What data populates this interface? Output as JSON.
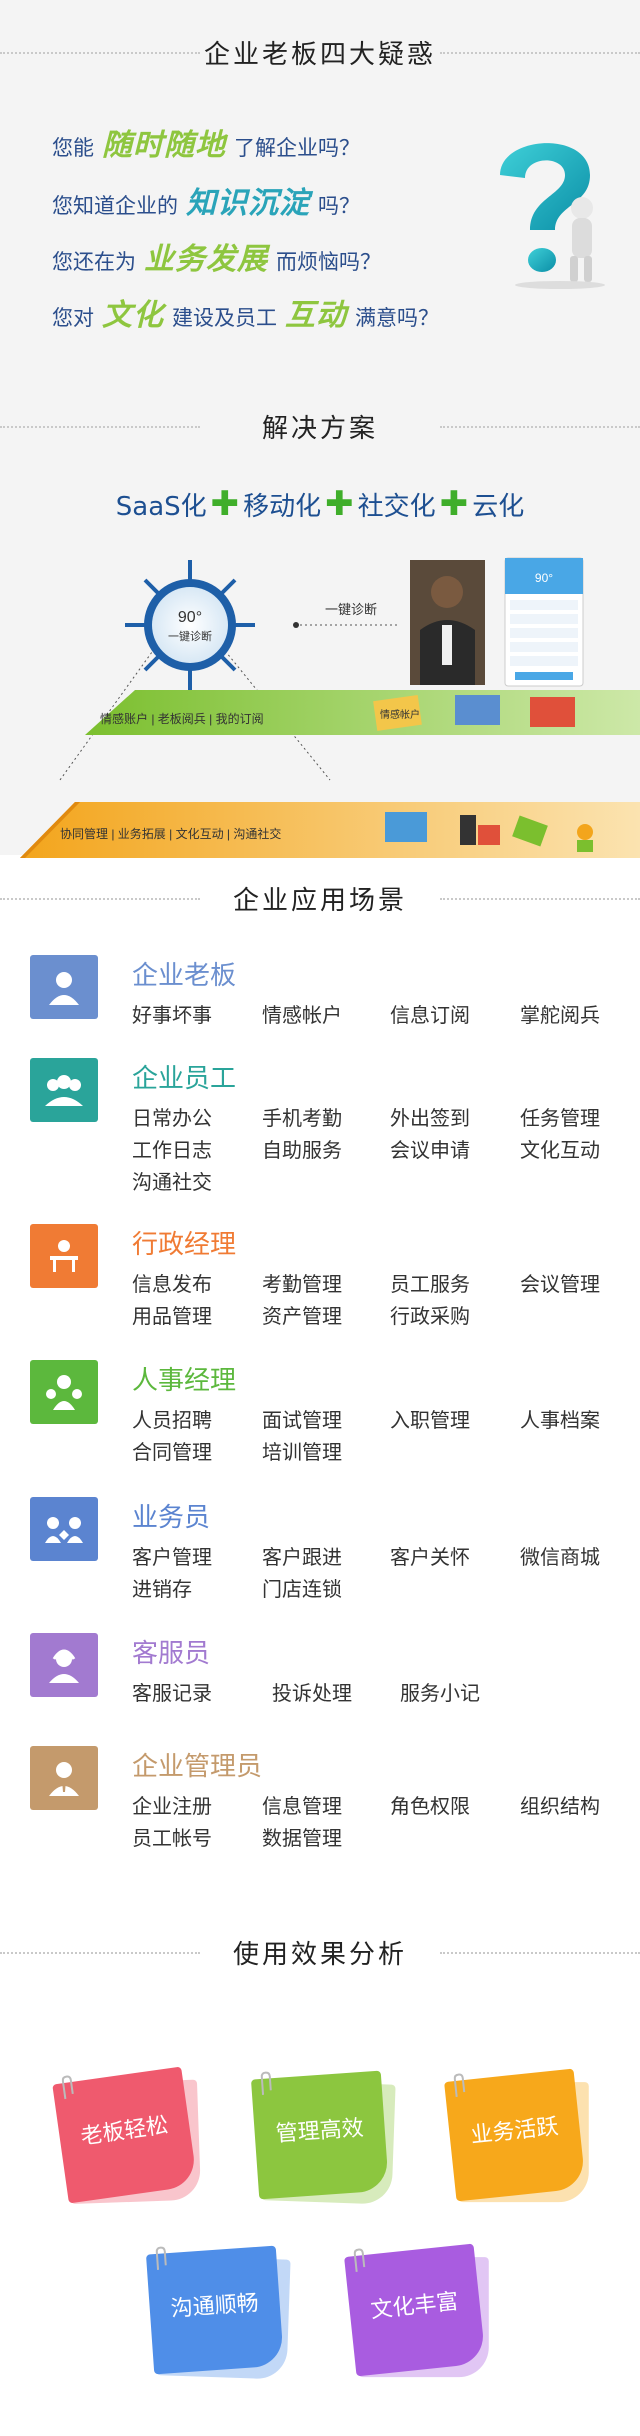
{
  "sections": {
    "doubts": "企业老板四大疑惑",
    "solution": "解决方案",
    "scenes": "企业应用场景",
    "effects": "使用效果分析"
  },
  "questions": [
    {
      "pre": "您能",
      "hl": "随时随地",
      "post": "了解企业吗？",
      "color": "#8ec63f"
    },
    {
      "pre": "您知道企业的",
      "hl": "知识沉淀",
      "post": "吗？",
      "color": "#2aa4b9"
    },
    {
      "pre": "您还在为",
      "hl": "业务发展",
      "post": "而烦恼吗？",
      "color": "#8ec63f"
    },
    {
      "pre": "您对",
      "hl": "文化",
      "mid": "建设及员工",
      "hl2": "互动",
      "post": "满意吗？",
      "color": "#8ec63f"
    }
  ],
  "tagline": {
    "p1": "SaaS化",
    "p2": "移动化",
    "p3": "社交化",
    "p4": "云化",
    "plus": "✚"
  },
  "pyramid": {
    "dial_value": "90°",
    "dial_label": "一键诊断",
    "arrow_label": "一键诊断",
    "level1": "情感账户 | 老板阅兵 | 我的订阅",
    "level2": "协同管理 | 业务拓展 | 文化互动 | 沟通社交",
    "card_label": "情感帐户",
    "phone_value": "90°"
  },
  "scenes": [
    {
      "name": "企业老板",
      "color": "#6b8fcf",
      "icon": "boss-icon",
      "items": [
        "好事坏事",
        "情感帐户",
        "信息订阅",
        "掌舵阅兵"
      ]
    },
    {
      "name": "企业员工",
      "color": "#2aa49a",
      "icon": "staff-icon",
      "items": [
        "日常办公",
        "手机考勤",
        "外出签到",
        "任务管理",
        "工作日志",
        "自助服务",
        "会议申请",
        "文化互动",
        "沟通社交"
      ]
    },
    {
      "name": "行政经理",
      "color": "#f07b34",
      "icon": "admin-icon",
      "items": [
        "信息发布",
        "考勤管理",
        "员工服务",
        "会议管理",
        "用品管理",
        "资产管理",
        "行政采购"
      ]
    },
    {
      "name": "人事经理",
      "color": "#5cb83d",
      "icon": "hr-icon",
      "items": [
        "人员招聘",
        "面试管理",
        "入职管理",
        "人事档案",
        "合同管理",
        "培训管理"
      ]
    },
    {
      "name": "业务员",
      "color": "#5b84d0",
      "icon": "sales-icon",
      "items": [
        "客户管理",
        "客户跟进",
        "客户关怀",
        "微信商城",
        "进销存",
        "门店连锁"
      ]
    },
    {
      "name": "客服员",
      "color": "#a27ad0",
      "icon": "service-icon",
      "items": [
        "客服记录",
        "投诉处理",
        "服务小记"
      ]
    },
    {
      "name": "企业管理员",
      "color": "#c49a6c",
      "icon": "manager-icon",
      "items": [
        "企业注册",
        "信息管理",
        "角色权限",
        "组织结构",
        "员工帐号",
        "数据管理"
      ]
    }
  ],
  "effects": [
    {
      "label": "老板轻松",
      "color": "#ef5a6e"
    },
    {
      "label": "管理高效",
      "color": "#8cc63f"
    },
    {
      "label": "业务活跃",
      "color": "#f7a81b"
    },
    {
      "label": "沟通顺畅",
      "color": "#4f8ee8"
    },
    {
      "label": "文化丰富",
      "color": "#a95ce0"
    }
  ]
}
